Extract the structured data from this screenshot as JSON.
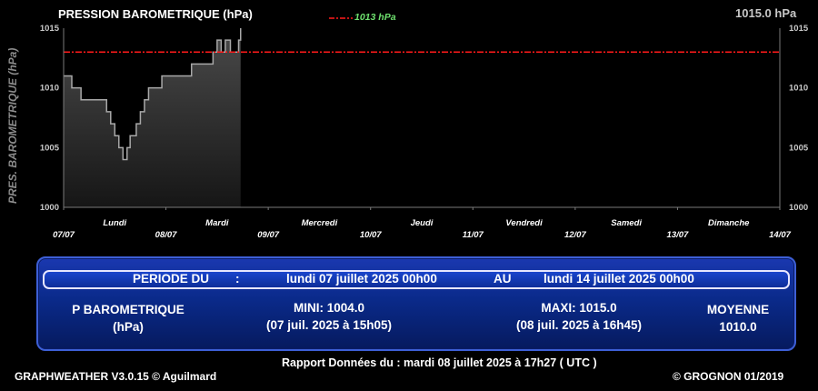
{
  "header": {
    "title": "PRESSION BAROMETRIQUE (hPa)",
    "current_value": "1015.0 hPa",
    "reference_label": "1013 hPa"
  },
  "chart_data": {
    "type": "area",
    "title": "PRESSION BAROMETRIQUE (hPa)",
    "ylabel": "PRES. BAROMETRIQUE (hPa)",
    "ylim": [
      1000,
      1015
    ],
    "yticks": [
      "1015",
      "1010",
      "1005",
      "1000"
    ],
    "x_range_days": [
      0,
      7
    ],
    "x_date_ticks": [
      "07/07",
      "08/07",
      "09/07",
      "10/07",
      "11/07",
      "12/07",
      "13/07",
      "14/07"
    ],
    "x_day_labels": [
      "Lundi",
      "Mardi",
      "Mercredi",
      "Jeudi",
      "Vendredi",
      "Samedi",
      "Dimanche"
    ],
    "reference_line": {
      "value": 1013,
      "label": "1013 hPa",
      "color": "#ff1a1a"
    },
    "series": [
      {
        "values_x_days": [
          0,
          0.08,
          0.17,
          0.29,
          0.42,
          0.46,
          0.5,
          0.54,
          0.58,
          0.62,
          0.65,
          0.71,
          0.75,
          0.79,
          0.83,
          0.88,
          0.96,
          1.04,
          1.13,
          1.25,
          1.38,
          1.46,
          1.5,
          1.54,
          1.58,
          1.63,
          1.71,
          1.73
        ],
        "values_y": [
          1011,
          1010,
          1009,
          1009,
          1008,
          1007,
          1006,
          1005,
          1004,
          1005,
          1006,
          1007,
          1008,
          1009,
          1010,
          1010,
          1011,
          1011,
          1011,
          1012,
          1012,
          1013,
          1014,
          1013,
          1014,
          1013,
          1014,
          1015
        ]
      }
    ],
    "grid": false
  },
  "panel": {
    "periode_label": "PERIODE DU",
    "colon": ":",
    "date_start": "lundi 07 juillet 2025 00h00",
    "au_label": "AU",
    "date_end": "lundi 14 juillet 2025 00h00",
    "param_name_line1": "P BAROMETRIQUE",
    "param_name_line2": "(hPa)",
    "mini_label": "MINI:  1004.0",
    "mini_date": "(07 juil. 2025 à 15h05)",
    "maxi_label": "MAXI:  1015.0",
    "maxi_date": "(08 juil. 2025 à 16h45)",
    "moyenne_label": "MOYENNE",
    "moyenne_value": "1010.0"
  },
  "footer": {
    "left": "GRAPHWEATHER V3.0.15 © Aguilmard",
    "center": "Rapport Données du :  mardi 08 juillet 2025 à 17h27 ( UTC )",
    "right": "© GROGNON 01/2019"
  }
}
